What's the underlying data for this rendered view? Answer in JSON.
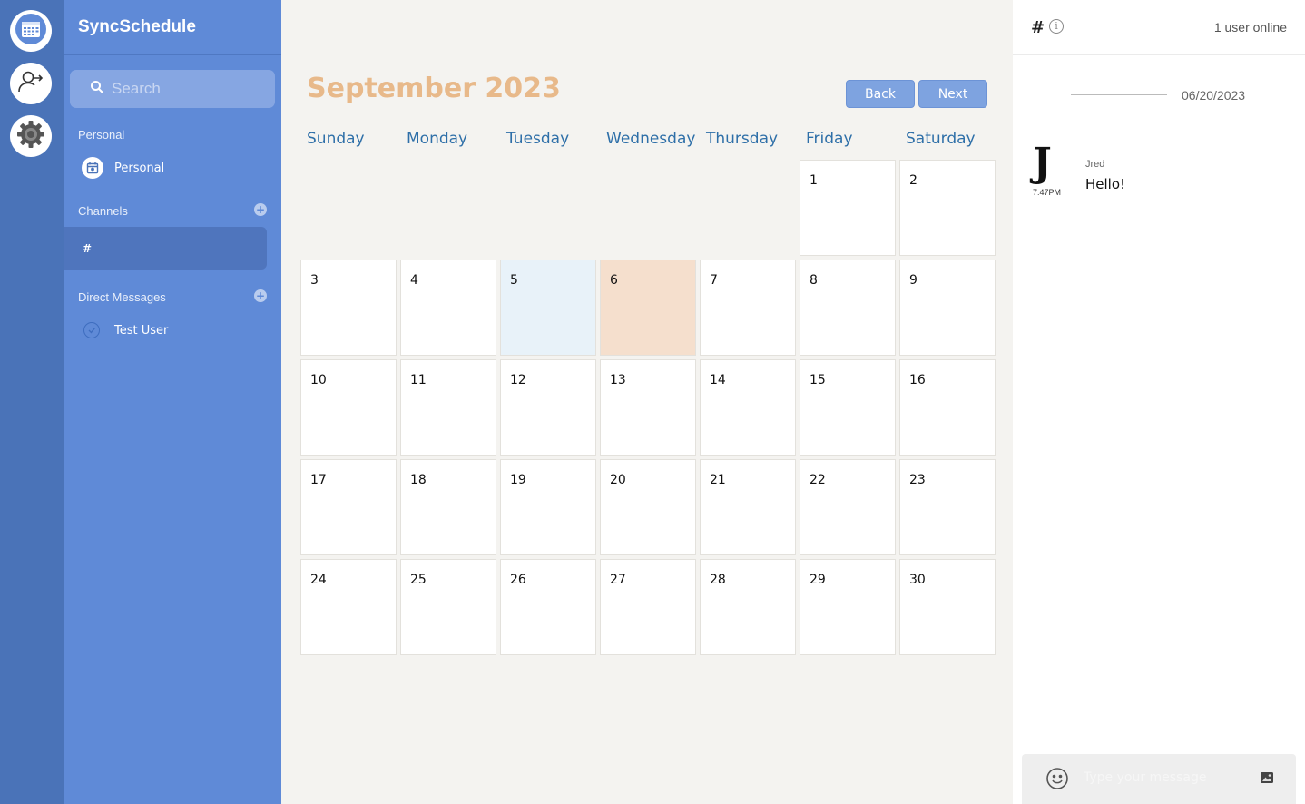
{
  "app": {
    "name": "SyncSchedule"
  },
  "rail": {
    "items": [
      {
        "icon": "calendar-icon"
      },
      {
        "icon": "user-switch-icon"
      },
      {
        "icon": "gear-icon"
      }
    ]
  },
  "sidebar": {
    "search_placeholder": "Search",
    "personal_section": "Personal",
    "personal_item": "Personal",
    "channels_section": "Channels",
    "active_channel": "#",
    "dm_section": "Direct Messages",
    "dm_item": "Test User",
    "colors": {
      "rail": "#4a73b8",
      "sidebar": "#5f8ad7",
      "active": "#4f75bd"
    }
  },
  "calendar": {
    "title": "September 2023",
    "back_label": "Back",
    "next_label": "Next",
    "weekdays": [
      "Sunday",
      "Monday",
      "Tuesday",
      "Wednesday",
      "Thursday",
      "Friday",
      "Saturday"
    ],
    "first_weekday_index": 5,
    "days_in_month": 30,
    "highlight_today": 5,
    "highlight_selected": 6,
    "colors": {
      "title": "#e8b98a",
      "weekday": "#2e6fa8",
      "today": "#e8f2f9",
      "selected": "#f5dfcd"
    }
  },
  "chat": {
    "channel": "#",
    "online": "1 user online",
    "date": "06/20/2023",
    "messages": [
      {
        "avatar": "J",
        "time": "7:47PM",
        "author": "Jred",
        "text": "Hello!"
      }
    ],
    "composer_placeholder": "Type your message"
  }
}
